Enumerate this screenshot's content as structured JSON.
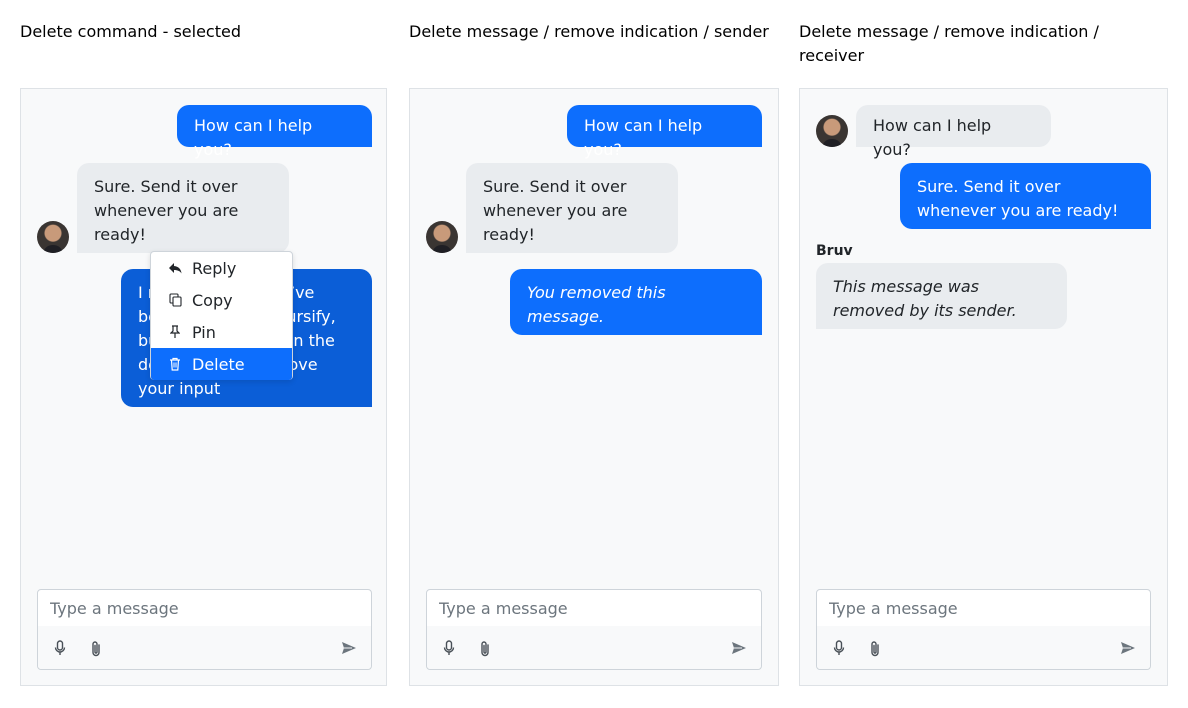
{
  "columns": [
    {
      "title": "Delete command - selected"
    },
    {
      "title": "Delete message / remove indication / sender"
    },
    {
      "title": "Delete message / remove indication / receiver"
    }
  ],
  "panel1": {
    "msg_out_1": "How can I help you?",
    "msg_in_1": "Sure. Send it over whenever you are ready!",
    "msg_out_2": "I need your input. I’ve been working on Kursify, but I’m stuck. I’m on the design and would love your input",
    "context_menu": {
      "reply": "Reply",
      "copy": "Copy",
      "pin": "Pin",
      "delete": "Delete"
    }
  },
  "panel2": {
    "msg_out_1": "How can I help you?",
    "msg_in_1": "Sure. Send it over whenever you are ready!",
    "removed": "You removed this message."
  },
  "panel3": {
    "msg_in_1": "How can I help you?",
    "msg_out_1": "Sure. Send it over whenever you are ready!",
    "sender_name": "Bruv",
    "removed": "This message was removed by its sender."
  },
  "composer": {
    "placeholder": "Type a message"
  },
  "icons": {
    "mic": "microphone-icon",
    "attach": "paperclip-icon",
    "send": "send-icon",
    "reply": "reply-icon",
    "copy": "copy-icon",
    "pin": "pin-icon",
    "delete": "trash-icon"
  },
  "colors": {
    "accent": "#0d6efd",
    "bubble_in": "#e9ecef",
    "panel_bg": "#f8f9fa"
  }
}
